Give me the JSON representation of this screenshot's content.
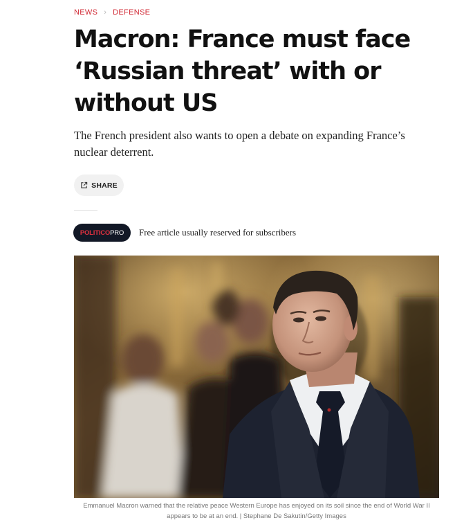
{
  "breadcrumb": {
    "items": [
      "NEWS",
      "DEFENSE"
    ],
    "separator": "›"
  },
  "headline": "Macron: France must face ‘Russian threat’ with or without US",
  "dek": "The French president also wants to open a debate on expanding France’s nuclear deterrent.",
  "share": {
    "label": "SHARE",
    "icon": "share-icon"
  },
  "pro_badge": {
    "part1": "POLITICO",
    "part2": "PRO",
    "colors": {
      "background": "#121826",
      "accent": "#e0313f"
    }
  },
  "pro_note": "Free article usually reserved for subscribers",
  "photo": {
    "caption": "Emmanuel Macron warned that the relative peace Western Europe has enjoyed on its soil since the end of World War II appears to be at an end. | Stephane De Sakutin/Getty Images"
  },
  "colors": {
    "accent": "#d12b36",
    "headline": "#111111",
    "caption": "#777777"
  }
}
